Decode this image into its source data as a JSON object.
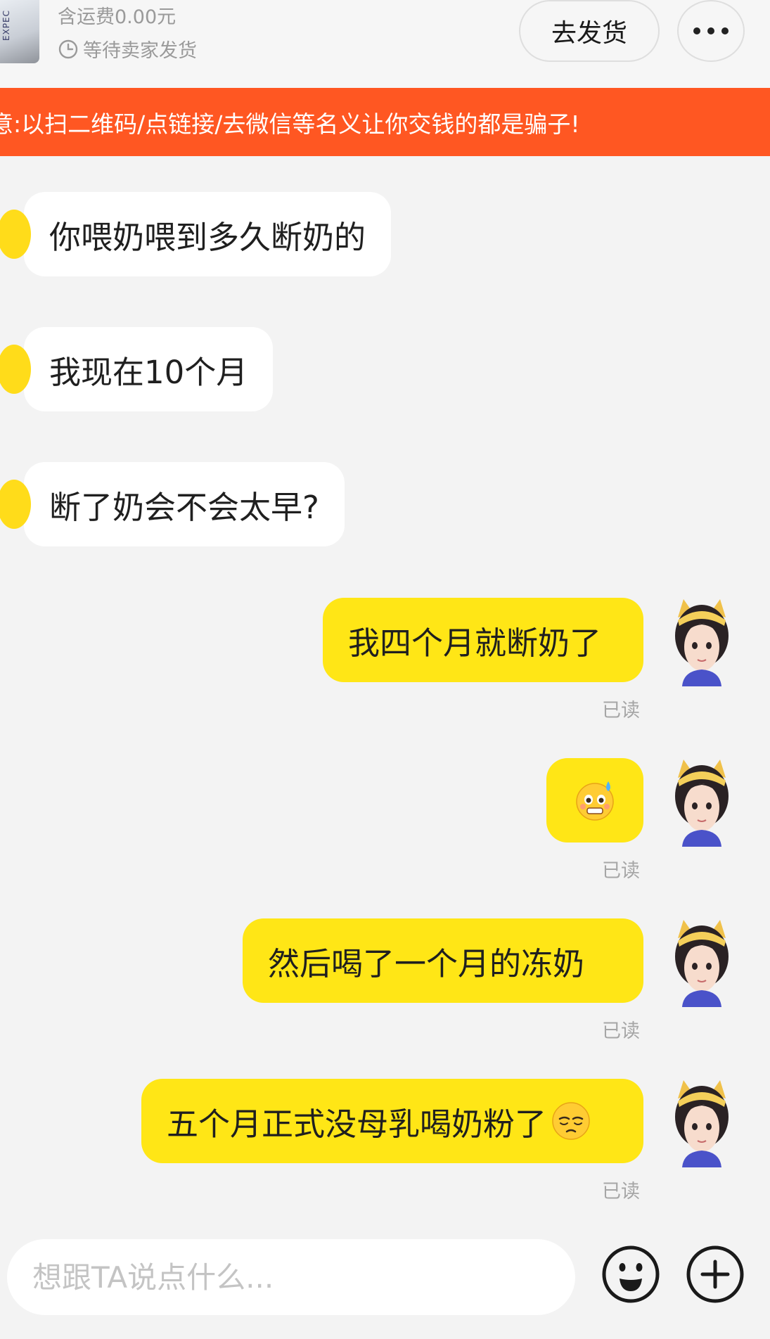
{
  "order": {
    "thumb_label": "EXPEC",
    "shipping_fee": "含运费0.00元",
    "status": "等待卖家发货",
    "ship_button_label": "去发货",
    "more_icon": "more-dots-icon"
  },
  "warning": {
    "text": "意:以扫二维码/点链接/去微信等名义让你交钱的都是骗子!"
  },
  "messages": [
    {
      "side": "incoming",
      "text": "你喂奶喂到多久断奶的"
    },
    {
      "side": "incoming",
      "text": "我现在10个月"
    },
    {
      "side": "incoming",
      "text": "断了奶会不会太早?"
    },
    {
      "side": "outgoing",
      "text": "我四个月就断奶了",
      "status": "已读"
    },
    {
      "side": "outgoing",
      "text": "",
      "emoji": "anxious-sweat-emoji",
      "status": "已读"
    },
    {
      "side": "outgoing",
      "text": "然后喝了一个月的冻奶",
      "status": "已读"
    },
    {
      "side": "outgoing",
      "text": "五个月正式没母乳喝奶粉了",
      "emoji": "pensive-face-emoji",
      "status": "已读"
    }
  ],
  "input": {
    "placeholder": "想跟TA说点什么...",
    "emoji_icon": "smiley-icon",
    "plus_icon": "plus-icon"
  },
  "colors": {
    "banner": "#ff5722",
    "outgoing_bubble": "#ffe616",
    "incoming_bubble": "#ffffff",
    "background": "#f3f3f3"
  }
}
